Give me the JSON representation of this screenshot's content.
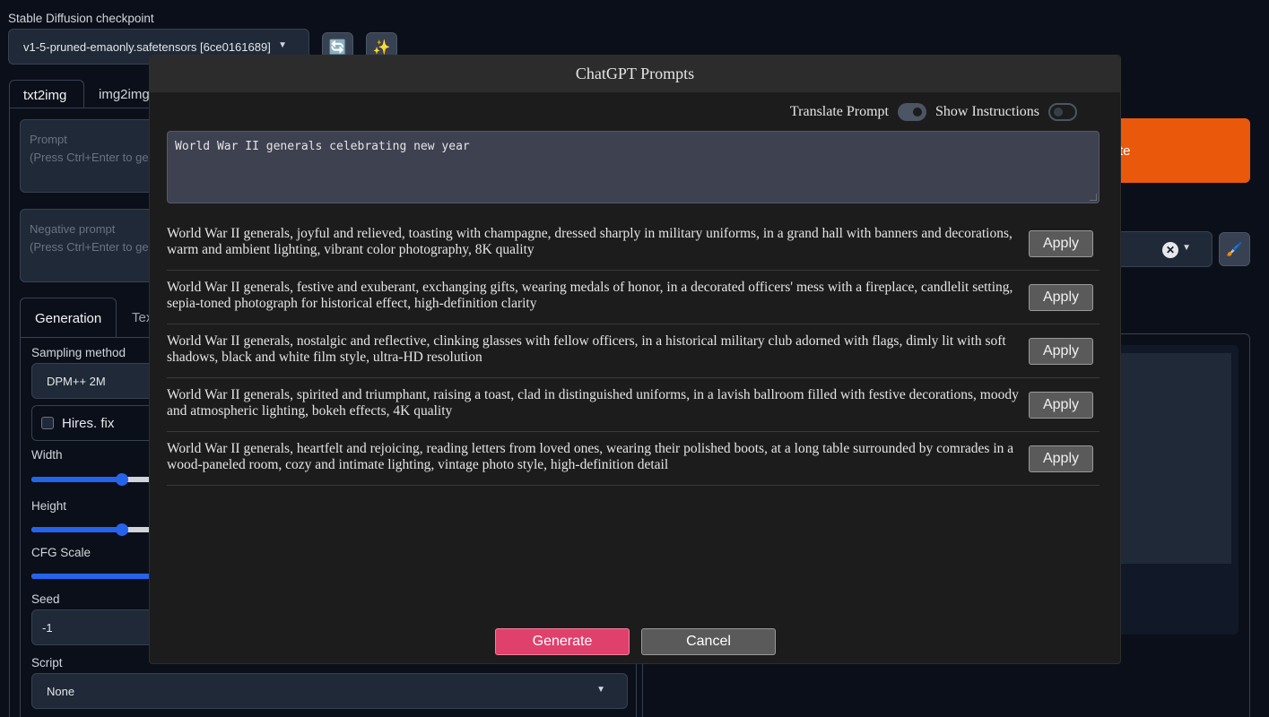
{
  "app": {
    "checkpoint_label": "Stable Diffusion checkpoint",
    "checkpoint_value": "v1-5-pruned-emaonly.safetensors [6ce0161689]",
    "refresh_icon": "🔄",
    "magic_icon": "✨",
    "tabs": [
      {
        "label": "txt2img"
      },
      {
        "label": "img2img"
      }
    ],
    "prompt_label": "Prompt",
    "prompt_hint": "(Press Ctrl+Enter to ge",
    "negative_label": "Negative prompt",
    "negative_hint": "(Press Ctrl+Enter to ge",
    "sub_tabs": [
      {
        "label": "Generation"
      },
      {
        "label": "Tex"
      }
    ],
    "sampling_label": "Sampling method",
    "sampling_value": "DPM++ 2M",
    "hires_label": "Hires. fix",
    "width_label": "Width",
    "height_label": "Height",
    "cfg_label": "CFG Scale",
    "seed_label": "Seed",
    "seed_value": "-1",
    "script_label": "Script",
    "script_value": "None",
    "generate_partial": "te",
    "paint_icon": "🖌️",
    "width_level": 0.63,
    "height_level": 0.63,
    "cfg_level": 1.0,
    "accent_color": "#ea580c",
    "slider_color": "#2563eb"
  },
  "modal": {
    "title": "ChatGPT Prompts",
    "translate_label": "Translate Prompt",
    "translate_on": true,
    "instructions_label": "Show Instructions",
    "instructions_on": false,
    "prompt_value": "World War II generals celebrating new year",
    "results": [
      {
        "text": "World War II generals, joyful and relieved, toasting with champagne, dressed sharply in military uniforms, in a grand hall with banners and decorations, warm and ambient lighting, vibrant color photography, 8K quality",
        "apply": "Apply"
      },
      {
        "text": "World War II generals, festive and exuberant, exchanging gifts, wearing medals of honor, in a decorated officers' mess with a fireplace, candlelit setting, sepia-toned photograph for historical effect, high-definition clarity",
        "apply": "Apply"
      },
      {
        "text": "World War II generals, nostalgic and reflective, clinking glasses with fellow officers, in a historical military club adorned with flags, dimly lit with soft shadows, black and white film style, ultra-HD resolution",
        "apply": "Apply"
      },
      {
        "text": "World War II generals, spirited and triumphant, raising a toast, clad in distinguished uniforms, in a lavish ballroom filled with festive decorations, moody and atmospheric lighting, bokeh effects, 4K quality",
        "apply": "Apply"
      },
      {
        "text": "World War II generals, heartfelt and rejoicing, reading letters from loved ones, wearing their polished boots, at a long table surrounded by comrades in a wood-paneled room, cozy and intimate lighting, vintage photo style, high-definition detail",
        "apply": "Apply"
      }
    ],
    "generate_label": "Generate",
    "cancel_label": "Cancel",
    "generate_color": "#e0406c"
  }
}
